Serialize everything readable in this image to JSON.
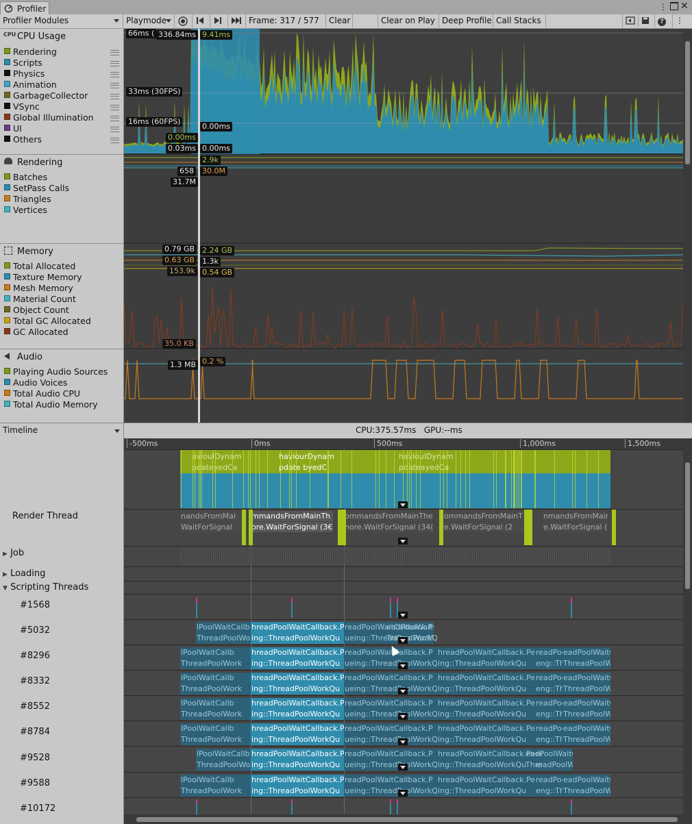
{
  "window": {
    "tab_title": "Profiler"
  },
  "toolbar": {
    "modules_label": "Profiler Modules",
    "playmode_label": "Playmode",
    "frame_label": "Frame: 317 / 577",
    "clear_label": "Clear",
    "clear_on_play_label": "Clear on Play",
    "deep_profile_label": "Deep Profile",
    "call_stacks_label": "Call Stacks"
  },
  "modules": {
    "cpu": {
      "title": "CPU Usage",
      "items": [
        {
          "label": "Rendering",
          "color": "#7c9a1c"
        },
        {
          "label": "Scripts",
          "color": "#2f8cad"
        },
        {
          "label": "Physics",
          "color": "#111111"
        },
        {
          "label": "Animation",
          "color": "#45a4c0"
        },
        {
          "label": "GarbageCollector",
          "color": "#6f6a22"
        },
        {
          "label": "VSync",
          "color": "#111111"
        },
        {
          "label": "Global Illumination",
          "color": "#8a3a1c"
        },
        {
          "label": "UI",
          "color": "#6a3f8a"
        },
        {
          "label": "Others",
          "color": "#111111"
        }
      ]
    },
    "rendering": {
      "title": "Rendering",
      "items": [
        {
          "label": "Batches",
          "color": "#7c9a1c"
        },
        {
          "label": "SetPass Calls",
          "color": "#2f8cad"
        },
        {
          "label": "Triangles",
          "color": "#c87a1c"
        },
        {
          "label": "Vertices",
          "color": "#45b0c0"
        }
      ]
    },
    "memory": {
      "title": "Memory",
      "items": [
        {
          "label": "Total Allocated",
          "color": "#7c9a1c"
        },
        {
          "label": "Texture Memory",
          "color": "#2f8cad"
        },
        {
          "label": "Mesh Memory",
          "color": "#c87a1c"
        },
        {
          "label": "Material Count",
          "color": "#45b0c0"
        },
        {
          "label": "Object Count",
          "color": "#6f6a22"
        },
        {
          "label": "Total GC Allocated",
          "color": "#c8a21c"
        },
        {
          "label": "GC Allocated",
          "color": "#8a3a1c"
        }
      ]
    },
    "audio": {
      "title": "Audio",
      "items": [
        {
          "label": "Playing Audio Sources",
          "color": "#7c9a1c"
        },
        {
          "label": "Audio Voices",
          "color": "#2f8cad"
        },
        {
          "label": "Total Audio CPU",
          "color": "#c87a1c"
        },
        {
          "label": "Total Audio Memory",
          "color": "#45b0c0"
        }
      ]
    }
  },
  "cpu_chart": {
    "line_66": "66ms (",
    "line_33": "33ms (30FPS)",
    "line_16": "16ms (60FPS)",
    "v_a": "336.84ms",
    "v_b": "9.41ms",
    "v_c": "0.00ms",
    "v_d": "0.00ms",
    "v_e": "0.03ms",
    "v_f": "0.00ms"
  },
  "render_chart": {
    "v_a": "2.9k",
    "v_b": "658",
    "v_c": "30.0M",
    "v_d": "31.7M"
  },
  "memory_chart": {
    "v_a": "0.79 GB",
    "v_b": "2.24 GB",
    "v_c": "0.63 GB",
    "v_d": "1.3k",
    "v_e": "153.9k",
    "v_f": "0.54 GB",
    "v_g": "35.0 KB"
  },
  "audio_chart": {
    "v_a": "1.3 MB",
    "v_b": "0.2 %"
  },
  "timeline": {
    "view_label": "Timeline",
    "cpu_gpu": "CPU:375.57ms   GPU:--ms",
    "ruler": [
      "-500ms",
      "0ms",
      "500ms",
      "1,000ms",
      "1,500ms"
    ],
    "tracks": {
      "render_thread": "Render Thread",
      "job": "Job",
      "loading": "Loading",
      "scripting": "Scripting Threads",
      "threads": [
        "#1568",
        "#5032",
        "#8296",
        "#8332",
        "#8552",
        "#8784",
        "#9528",
        "#9588",
        "#10172"
      ]
    },
    "main_labels": [
      "avioulDynam",
      "haviourDynam",
      "havioulDynam",
      "pdate byedC",
      "pdateyedCa",
      "pdateayedCa"
    ],
    "render_labels": [
      "nandsFromMai",
      "mmandsFromMainTh",
      "ommandsFromMainThe",
      "ommandsFromMainT",
      "nmandsFromMain",
      "WaitForSignal",
      "ore.WaitForSignal (3€",
      "hore.WaitForSignal (34(",
      "e.WaitForSignal (2",
      "e.WaitForSignal ("
    ],
    "pool_row1": [
      "lPoolWaitCallb",
      "hreadPoolWaitCallback.P",
      "readPoolWaitCallback.P",
      "hreadPoolWaitCallback.Pe",
      "readPoolWaitCallback.",
      "eadPoolWaitCallback"
    ],
    "pool_row2": [
      "ThreadPoolWork",
      "ing::ThreadPoolWorkQu",
      "ueing::ThreadPoolWorkQu",
      "ing::ThreadPoolWorkQu",
      "eng::ThreadPoolWorkQu",
      "ThreadPoolWorkQ"
    ]
  },
  "icons": {
    "profiler": "profiler-icon",
    "record": "record-icon",
    "first": "first-frame-icon",
    "prev": "prev-frame-icon",
    "next": "next-frame-icon",
    "last": "last-frame-icon"
  }
}
